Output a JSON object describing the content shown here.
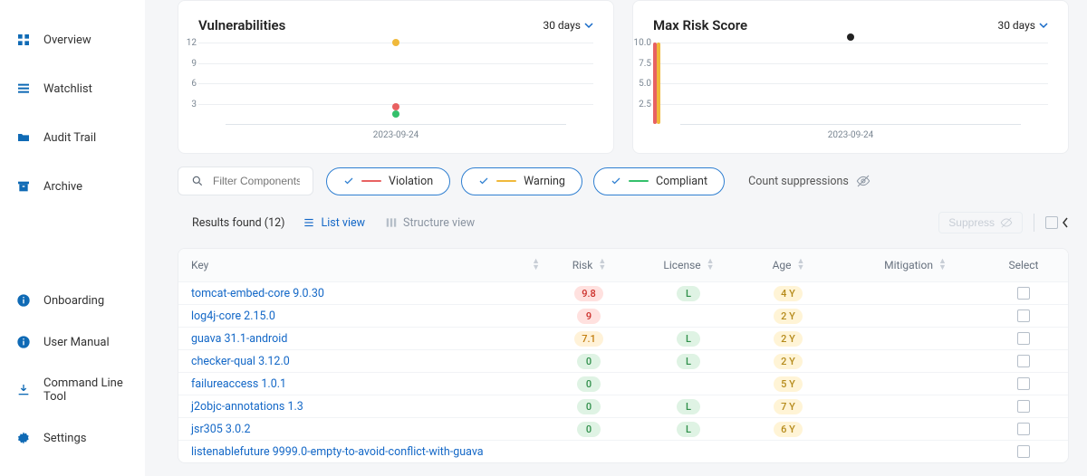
{
  "sidebar": {
    "top": [
      {
        "label": "Overview",
        "icon": "grid-icon"
      },
      {
        "label": "Watchlist",
        "icon": "list-icon"
      },
      {
        "label": "Audit Trail",
        "icon": "folder-icon"
      },
      {
        "label": "Archive",
        "icon": "archive-icon"
      }
    ],
    "bottom": [
      {
        "label": "Onboarding",
        "icon": "info-icon"
      },
      {
        "label": "User Manual",
        "icon": "info-icon"
      },
      {
        "label": "Command Line Tool",
        "icon": "download-icon"
      },
      {
        "label": "Settings",
        "icon": "gear-icon"
      }
    ]
  },
  "charts": {
    "vuln": {
      "title": "Vulnerabilities",
      "period": "30 days",
      "xaxis": "2023-09-24",
      "ylabels": [
        "12",
        "9",
        "6",
        "3"
      ],
      "points": [
        {
          "y": 12,
          "color": "#f0b93b"
        },
        {
          "y": 2.6,
          "color": "#e86161"
        },
        {
          "y": 1.5,
          "color": "#34c06b"
        }
      ],
      "ymax": 12
    },
    "risk": {
      "title": "Max Risk Score",
      "period": "30 days",
      "xaxis": "2023-09-24",
      "ylabels": [
        "10.0",
        "7.5",
        "5.0",
        "2.5"
      ],
      "points": [
        {
          "y": 10.5,
          "color": "#222"
        }
      ],
      "ymax": 10,
      "bars": [
        {
          "color": "#e86161",
          "top": 0,
          "height": 90
        },
        {
          "color": "#f0b93b",
          "top": 0,
          "height": 90,
          "offset": 4
        }
      ]
    }
  },
  "filters": {
    "search_placeholder": "Filter Components",
    "pills": [
      {
        "label": "Violation",
        "color": "#e86161"
      },
      {
        "label": "Warning",
        "color": "#f0b93b"
      },
      {
        "label": "Compliant",
        "color": "#34c06b"
      }
    ],
    "count_suppressions_label": "Count suppressions"
  },
  "results": {
    "found_prefix": "Results found",
    "count": "(12)",
    "list_view_label": "List view",
    "structure_view_label": "Structure view",
    "suppress_label": "Suppress"
  },
  "table": {
    "headers": {
      "key": "Key",
      "risk": "Risk",
      "license": "License",
      "age": "Age",
      "mitigation": "Mitigation",
      "select": "Select"
    },
    "rows": [
      {
        "key": "tomcat-embed-core 9.0.30",
        "risk": "9.8",
        "risk_cls": "badge-red",
        "license": "L",
        "age": "4 Y"
      },
      {
        "key": "log4j-core 2.15.0",
        "risk": "9",
        "risk_cls": "badge-red",
        "license": "",
        "age": "2 Y"
      },
      {
        "key": "guava 31.1-android",
        "risk": "7.1",
        "risk_cls": "badge-orange",
        "license": "L",
        "age": "2 Y"
      },
      {
        "key": "checker-qual 3.12.0",
        "risk": "0",
        "risk_cls": "badge-green",
        "license": "L",
        "age": "2 Y"
      },
      {
        "key": "failureaccess 1.0.1",
        "risk": "0",
        "risk_cls": "badge-green",
        "license": "",
        "age": "5 Y"
      },
      {
        "key": "j2objc-annotations 1.3",
        "risk": "0",
        "risk_cls": "badge-green",
        "license": "L",
        "age": "7 Y"
      },
      {
        "key": "jsr305 3.0.2",
        "risk": "0",
        "risk_cls": "badge-green",
        "license": "L",
        "age": "6 Y"
      },
      {
        "key": "listenablefuture 9999.0-empty-to-avoid-conflict-with-guava",
        "risk": "",
        "risk_cls": "",
        "license": "",
        "age": ""
      }
    ]
  },
  "chart_data": [
    {
      "type": "scatter",
      "title": "Vulnerabilities",
      "x": [
        "2023-09-24"
      ],
      "series": [
        {
          "name": "Warning",
          "values": [
            12
          ],
          "color": "#f0b93b"
        },
        {
          "name": "Violation",
          "values": [
            2.6
          ],
          "color": "#e86161"
        },
        {
          "name": "Compliant",
          "values": [
            1.5
          ],
          "color": "#34c06b"
        }
      ],
      "ylim": [
        0,
        12
      ],
      "yticks": [
        3,
        6,
        9,
        12
      ],
      "xlabel": "",
      "ylabel": ""
    },
    {
      "type": "scatter",
      "title": "Max Risk Score",
      "x": [
        "2023-09-24"
      ],
      "series": [
        {
          "name": "Max",
          "values": [
            10.5
          ],
          "color": "#222"
        }
      ],
      "ylim": [
        0,
        10
      ],
      "yticks": [
        2.5,
        5.0,
        7.5,
        10.0
      ],
      "xlabel": "",
      "ylabel": ""
    }
  ]
}
